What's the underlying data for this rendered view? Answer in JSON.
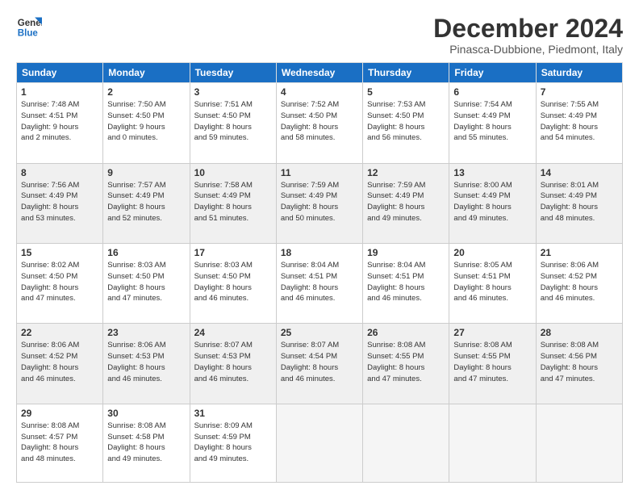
{
  "logo": {
    "line1": "General",
    "line2": "Blue"
  },
  "title": "December 2024",
  "subtitle": "Pinasca-Dubbione, Piedmont, Italy",
  "days_of_week": [
    "Sunday",
    "Monday",
    "Tuesday",
    "Wednesday",
    "Thursday",
    "Friday",
    "Saturday"
  ],
  "weeks": [
    [
      {
        "day": "1",
        "info": "Sunrise: 7:48 AM\nSunset: 4:51 PM\nDaylight: 9 hours\nand 2 minutes."
      },
      {
        "day": "2",
        "info": "Sunrise: 7:50 AM\nSunset: 4:50 PM\nDaylight: 9 hours\nand 0 minutes."
      },
      {
        "day": "3",
        "info": "Sunrise: 7:51 AM\nSunset: 4:50 PM\nDaylight: 8 hours\nand 59 minutes."
      },
      {
        "day": "4",
        "info": "Sunrise: 7:52 AM\nSunset: 4:50 PM\nDaylight: 8 hours\nand 58 minutes."
      },
      {
        "day": "5",
        "info": "Sunrise: 7:53 AM\nSunset: 4:50 PM\nDaylight: 8 hours\nand 56 minutes."
      },
      {
        "day": "6",
        "info": "Sunrise: 7:54 AM\nSunset: 4:49 PM\nDaylight: 8 hours\nand 55 minutes."
      },
      {
        "day": "7",
        "info": "Sunrise: 7:55 AM\nSunset: 4:49 PM\nDaylight: 8 hours\nand 54 minutes."
      }
    ],
    [
      {
        "day": "8",
        "info": "Sunrise: 7:56 AM\nSunset: 4:49 PM\nDaylight: 8 hours\nand 53 minutes."
      },
      {
        "day": "9",
        "info": "Sunrise: 7:57 AM\nSunset: 4:49 PM\nDaylight: 8 hours\nand 52 minutes."
      },
      {
        "day": "10",
        "info": "Sunrise: 7:58 AM\nSunset: 4:49 PM\nDaylight: 8 hours\nand 51 minutes."
      },
      {
        "day": "11",
        "info": "Sunrise: 7:59 AM\nSunset: 4:49 PM\nDaylight: 8 hours\nand 50 minutes."
      },
      {
        "day": "12",
        "info": "Sunrise: 7:59 AM\nSunset: 4:49 PM\nDaylight: 8 hours\nand 49 minutes."
      },
      {
        "day": "13",
        "info": "Sunrise: 8:00 AM\nSunset: 4:49 PM\nDaylight: 8 hours\nand 49 minutes."
      },
      {
        "day": "14",
        "info": "Sunrise: 8:01 AM\nSunset: 4:49 PM\nDaylight: 8 hours\nand 48 minutes."
      }
    ],
    [
      {
        "day": "15",
        "info": "Sunrise: 8:02 AM\nSunset: 4:50 PM\nDaylight: 8 hours\nand 47 minutes."
      },
      {
        "day": "16",
        "info": "Sunrise: 8:03 AM\nSunset: 4:50 PM\nDaylight: 8 hours\nand 47 minutes."
      },
      {
        "day": "17",
        "info": "Sunrise: 8:03 AM\nSunset: 4:50 PM\nDaylight: 8 hours\nand 46 minutes."
      },
      {
        "day": "18",
        "info": "Sunrise: 8:04 AM\nSunset: 4:51 PM\nDaylight: 8 hours\nand 46 minutes."
      },
      {
        "day": "19",
        "info": "Sunrise: 8:04 AM\nSunset: 4:51 PM\nDaylight: 8 hours\nand 46 minutes."
      },
      {
        "day": "20",
        "info": "Sunrise: 8:05 AM\nSunset: 4:51 PM\nDaylight: 8 hours\nand 46 minutes."
      },
      {
        "day": "21",
        "info": "Sunrise: 8:06 AM\nSunset: 4:52 PM\nDaylight: 8 hours\nand 46 minutes."
      }
    ],
    [
      {
        "day": "22",
        "info": "Sunrise: 8:06 AM\nSunset: 4:52 PM\nDaylight: 8 hours\nand 46 minutes."
      },
      {
        "day": "23",
        "info": "Sunrise: 8:06 AM\nSunset: 4:53 PM\nDaylight: 8 hours\nand 46 minutes."
      },
      {
        "day": "24",
        "info": "Sunrise: 8:07 AM\nSunset: 4:53 PM\nDaylight: 8 hours\nand 46 minutes."
      },
      {
        "day": "25",
        "info": "Sunrise: 8:07 AM\nSunset: 4:54 PM\nDaylight: 8 hours\nand 46 minutes."
      },
      {
        "day": "26",
        "info": "Sunrise: 8:08 AM\nSunset: 4:55 PM\nDaylight: 8 hours\nand 47 minutes."
      },
      {
        "day": "27",
        "info": "Sunrise: 8:08 AM\nSunset: 4:55 PM\nDaylight: 8 hours\nand 47 minutes."
      },
      {
        "day": "28",
        "info": "Sunrise: 8:08 AM\nSunset: 4:56 PM\nDaylight: 8 hours\nand 47 minutes."
      }
    ],
    [
      {
        "day": "29",
        "info": "Sunrise: 8:08 AM\nSunset: 4:57 PM\nDaylight: 8 hours\nand 48 minutes."
      },
      {
        "day": "30",
        "info": "Sunrise: 8:08 AM\nSunset: 4:58 PM\nDaylight: 8 hours\nand 49 minutes."
      },
      {
        "day": "31",
        "info": "Sunrise: 8:09 AM\nSunset: 4:59 PM\nDaylight: 8 hours\nand 49 minutes."
      },
      {
        "day": "",
        "info": ""
      },
      {
        "day": "",
        "info": ""
      },
      {
        "day": "",
        "info": ""
      },
      {
        "day": "",
        "info": ""
      }
    ]
  ]
}
